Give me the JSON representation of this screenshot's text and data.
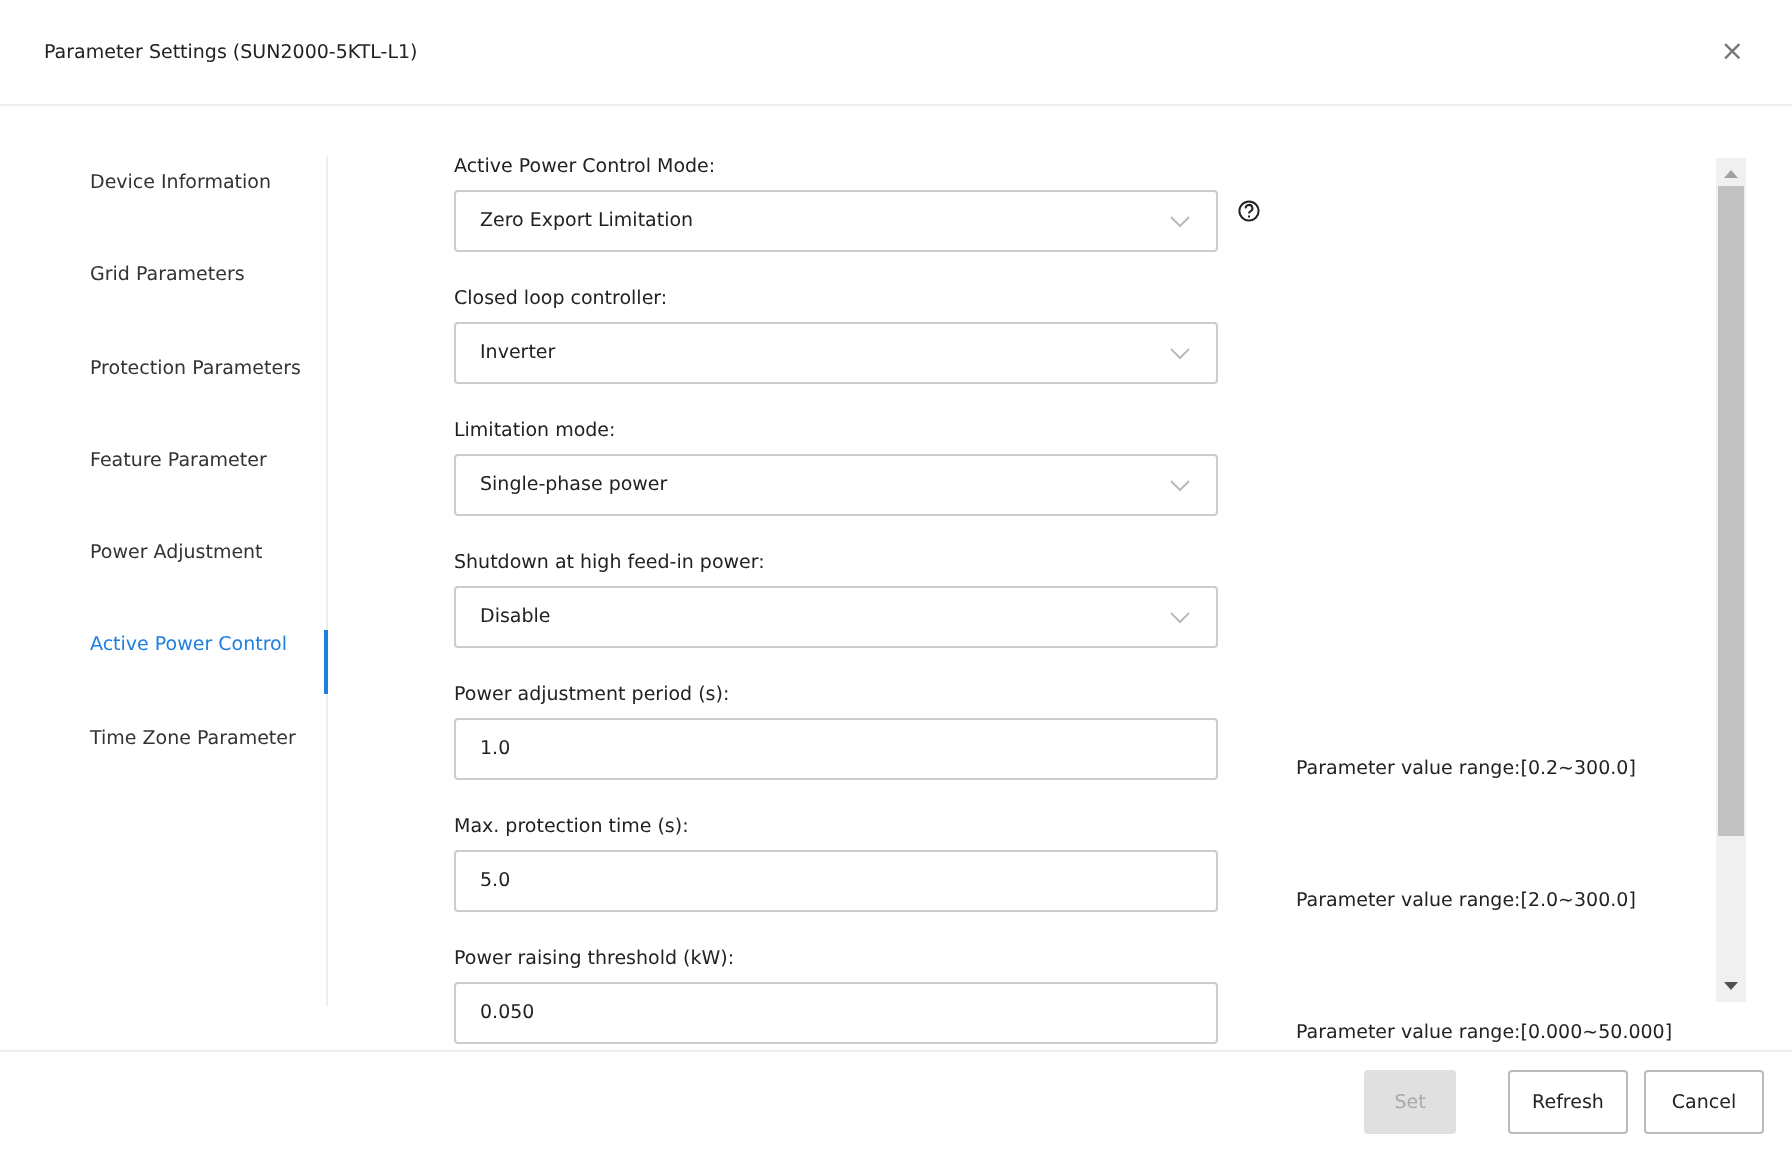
{
  "dialog": {
    "title": "Parameter Settings (SUN2000-5KTL-L1)",
    "close": "×"
  },
  "sidebar": {
    "items": [
      {
        "label": "Device Information",
        "selected": false
      },
      {
        "label": "Grid Parameters",
        "selected": false
      },
      {
        "label": "Protection Parameters",
        "selected": false
      },
      {
        "label": "Feature Parameter",
        "selected": false
      },
      {
        "label": "Power Adjustment",
        "selected": false
      },
      {
        "label": "Active Power Control",
        "selected": true
      },
      {
        "label": "Time Zone Parameter",
        "selected": false
      }
    ]
  },
  "form": {
    "fields": [
      {
        "kind": "select",
        "label": "Active Power Control Mode:",
        "value": "Zero Export Limitation",
        "help": true
      },
      {
        "kind": "select",
        "label": "Closed loop controller:",
        "value": "Inverter",
        "help": false
      },
      {
        "kind": "select",
        "label": "Limitation mode:",
        "value": "Single-phase power",
        "help": false
      },
      {
        "kind": "select",
        "label": "Shutdown at high feed-in power:",
        "value": "Disable",
        "help": false
      },
      {
        "kind": "input",
        "label": "Power adjustment period (s):",
        "value": "1.0",
        "range": "Parameter value range:[0.2~300.0]",
        "help": false
      },
      {
        "kind": "input",
        "label": "Max. protection time (s):",
        "value": "5.0",
        "range": "Parameter value range:[2.0~300.0]",
        "help": false
      },
      {
        "kind": "input",
        "label": "Power raising threshold (kW):",
        "value": "0.050",
        "range": "Parameter value range:[0.000~50.000]",
        "help": false
      }
    ]
  },
  "buttons": [
    {
      "label": "Set",
      "disabled": true
    },
    {
      "label": "Refresh",
      "disabled": false
    },
    {
      "label": "Cancel",
      "disabled": false
    }
  ]
}
